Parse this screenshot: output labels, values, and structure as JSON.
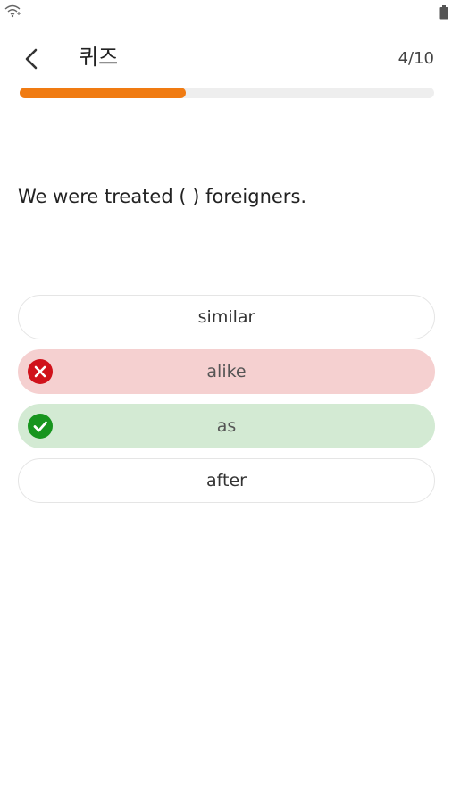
{
  "status_bar": {
    "wifi_icon": "wifi-icon",
    "battery_icon": "battery-icon"
  },
  "header": {
    "back_icon": "chevron-left-icon",
    "title": "퀴즈",
    "progress_text": "4/10"
  },
  "progress": {
    "fraction": 0.4,
    "fill_color": "#f07b12",
    "track_color": "#eeeeee"
  },
  "question": {
    "text": "We were treated ( ) foreigners."
  },
  "options": [
    {
      "label": "similar",
      "state": "neutral"
    },
    {
      "label": "alike",
      "state": "wrong",
      "icon": "x-circle-icon",
      "color": "#d0121b"
    },
    {
      "label": "as",
      "state": "correct",
      "icon": "check-circle-icon",
      "color": "#17951e"
    },
    {
      "label": "after",
      "state": "neutral"
    }
  ]
}
